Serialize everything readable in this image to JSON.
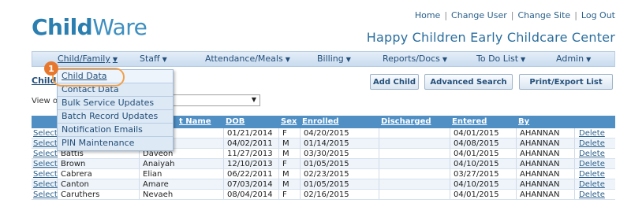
{
  "logo": {
    "part1": "Child",
    "part2": "Ware"
  },
  "top_links": [
    "Home",
    "Change User",
    "Change Site",
    "Log Out"
  ],
  "top_link_separator": "|",
  "center_name": "Happy Children Early Childcare Center",
  "nav": [
    {
      "label": "Child/Family"
    },
    {
      "label": "Staff"
    },
    {
      "label": "Attendance/Meals"
    },
    {
      "label": "Billing"
    },
    {
      "label": "Reports/Docs"
    },
    {
      "label": "To Do List"
    },
    {
      "label": "Admin"
    }
  ],
  "caret_glyph": "▼",
  "dropdown": [
    "Child Data",
    "Contact Data",
    "Bulk Service Updates",
    "Batch Record Updates",
    "Notification Emails",
    "PIN Maintenance"
  ],
  "step_badge": "1",
  "page_heading": "Child",
  "view_label": "View o",
  "buttons": {
    "add_child": "Add Child",
    "advanced_search": "Advanced Search",
    "print_export": "Print/Export List"
  },
  "table": {
    "headers": [
      "t Name",
      "DOB",
      "Sex",
      "Enrolled",
      "Discharged",
      "Entered",
      "By"
    ],
    "rows": [
      {
        "select": "Select",
        "last": "",
        "first": "ra",
        "dob": "01/21/2014",
        "sex": "F",
        "enrolled": "04/20/2015",
        "discharged": "",
        "entered": "04/01/2015",
        "by": "AHANNAN",
        "del": "Delete"
      },
      {
        "select": "Select",
        "last": "",
        "first": "ei",
        "dob": "04/02/2011",
        "sex": "M",
        "enrolled": "01/14/2015",
        "discharged": "",
        "entered": "04/08/2015",
        "by": "AHANNAN",
        "del": "Delete"
      },
      {
        "select": "Select",
        "last": "Battis",
        "first": "Daveon",
        "dob": "11/27/2013",
        "sex": "M",
        "enrolled": "03/30/2015",
        "discharged": "",
        "entered": "04/01/2015",
        "by": "AHANNAN",
        "del": "Delete"
      },
      {
        "select": "Select",
        "last": "Brown",
        "first": "Anaiyah",
        "dob": "12/10/2013",
        "sex": "F",
        "enrolled": "01/05/2015",
        "discharged": "",
        "entered": "04/10/2015",
        "by": "AHANNAN",
        "del": "Delete"
      },
      {
        "select": "Select",
        "last": "Cabrera",
        "first": "Elian",
        "dob": "06/22/2011",
        "sex": "M",
        "enrolled": "02/23/2015",
        "discharged": "",
        "entered": "03/27/2015",
        "by": "AHANNAN",
        "del": "Delete"
      },
      {
        "select": "Select",
        "last": "Canton",
        "first": "Amare",
        "dob": "07/03/2014",
        "sex": "M",
        "enrolled": "01/05/2015",
        "discharged": "",
        "entered": "04/10/2015",
        "by": "AHANNAN",
        "del": "Delete"
      },
      {
        "select": "Select",
        "last": "Caruthers",
        "first": "Nevaeh",
        "dob": "08/04/2014",
        "sex": "F",
        "enrolled": "02/16/2015",
        "discharged": "",
        "entered": "04/01/2015",
        "by": "AHANNAN",
        "del": "Delete"
      }
    ]
  },
  "colors": {
    "brand": "#2a7fb0",
    "header_bg": "#4f8fc4",
    "highlight": "#f0a04b",
    "badge": "#e8772e"
  }
}
